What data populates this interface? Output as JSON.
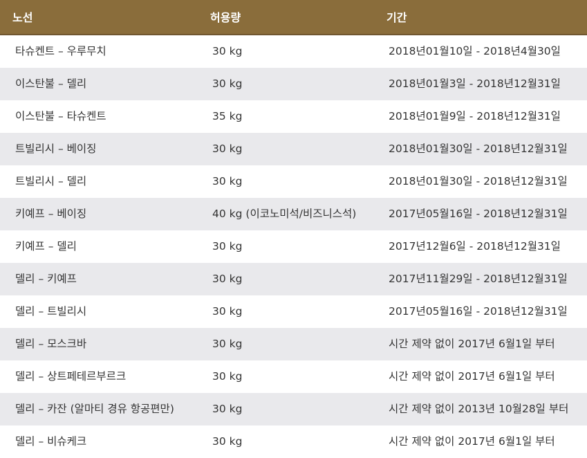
{
  "header": {
    "route": "노선",
    "allowance": "허용량",
    "period": "기간"
  },
  "colors": {
    "header_bg": "#8a6d3b",
    "row_alt_bg": "#e9e9ec",
    "text": "#333333"
  },
  "rows": [
    {
      "route": "타슈켄트 – 우루무치",
      "allowance": "30 kg",
      "period": "2018년01월10일 - 2018년4월30일"
    },
    {
      "route": "이스탄불 – 델리",
      "allowance": "30 kg",
      "period": "2018년01월3일 - 2018년12월31일"
    },
    {
      "route": "이스탄불 – 타슈켄트",
      "allowance": "35 kg",
      "period": "2018년01월9일 - 2018년12월31일"
    },
    {
      "route": "트빌리시 – 베이징",
      "allowance": "30 kg",
      "period": "2018년01월30일 - 2018년12월31일"
    },
    {
      "route": "트빌리시 – 델리",
      "allowance": "30 kg",
      "period": "2018년01월30일 - 2018년12월31일"
    },
    {
      "route": "키예프 – 베이징",
      "allowance": "40 kg (이코노미석/비즈니스석)",
      "period": "2017년05월16일 - 2018년12월31일"
    },
    {
      "route": "키예프 – 델리",
      "allowance": "30 kg",
      "period": "2017년12월6일 - 2018년12월31일"
    },
    {
      "route": "델리 – 키예프",
      "allowance": "30 kg",
      "period": "2017년11월29일 - 2018년12월31일"
    },
    {
      "route": "델리 – 트빌리시",
      "allowance": "30 kg",
      "period": "2017년05월16일 - 2018년12월31일"
    },
    {
      "route": "델리 – 모스크바",
      "allowance": "30 kg",
      "period": "시간 제약 없이 2017년 6월1일 부터"
    },
    {
      "route": "델리 – 상트페테르부르크",
      "allowance": "30 kg",
      "period": "시간 제약 없이 2017년 6월1일 부터"
    },
    {
      "route": "델리 – 카잔 (알마티 경유 항공편만)",
      "allowance": "30 kg",
      "period": "시간 제약 없이 2013년 10월28일 부터"
    },
    {
      "route": "델리 – 비슈케크",
      "allowance": "30 kg",
      "period": "시간 제약 없이 2017년 6월1일 부터"
    }
  ]
}
